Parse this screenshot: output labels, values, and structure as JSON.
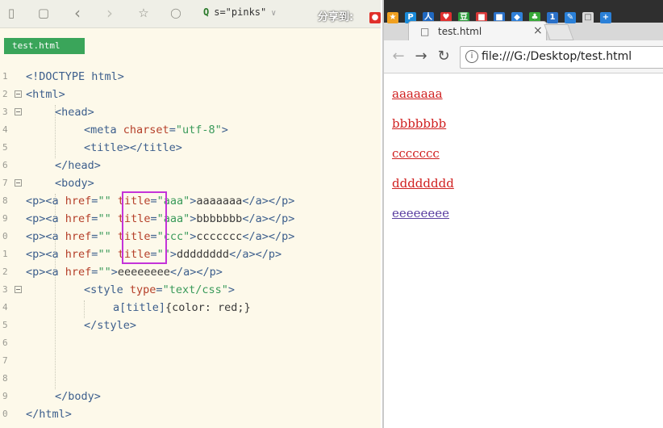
{
  "editor": {
    "search_text": "s=\"pinks\"",
    "tab_label": "test.html",
    "lines": [
      {
        "num": "1",
        "parts": [
          [
            "tag",
            "<!DOCTYPE html>"
          ]
        ]
      },
      {
        "num": "2",
        "parts": [
          [
            "tag",
            "<html>"
          ]
        ]
      },
      {
        "num": "3",
        "parts": [
          [
            "tag",
            "<head>"
          ]
        ]
      },
      {
        "num": "4",
        "parts": [
          [
            "tag",
            "<meta "
          ],
          [
            "attr",
            "charset"
          ],
          [
            "tag",
            "="
          ],
          [
            "str",
            "\"utf-8\""
          ],
          [
            "tag",
            ">"
          ]
        ]
      },
      {
        "num": "5",
        "parts": [
          [
            "tag",
            "<title></title>"
          ]
        ]
      },
      {
        "num": "6",
        "parts": [
          [
            "tag",
            "</head>"
          ]
        ]
      },
      {
        "num": "7",
        "parts": [
          [
            "tag",
            "<body>"
          ]
        ]
      },
      {
        "num": "8",
        "parts": [
          [
            "tag",
            "<p><a "
          ],
          [
            "attr",
            "href"
          ],
          [
            "tag",
            "="
          ],
          [
            "str",
            "\"\""
          ],
          [
            "tag",
            " "
          ],
          [
            "attr",
            "title"
          ],
          [
            "tag",
            "="
          ],
          [
            "str",
            "\"aaa\""
          ],
          [
            "tag",
            ">"
          ],
          [
            "txt",
            "aaaaaaa"
          ],
          [
            "tag",
            "</a></p>"
          ]
        ]
      },
      {
        "num": "9",
        "parts": [
          [
            "tag",
            "<p><a "
          ],
          [
            "attr",
            "href"
          ],
          [
            "tag",
            "="
          ],
          [
            "str",
            "\"\""
          ],
          [
            "tag",
            " "
          ],
          [
            "attr",
            "title"
          ],
          [
            "tag",
            "="
          ],
          [
            "str",
            "\"aaa\""
          ],
          [
            "tag",
            ">"
          ],
          [
            "txt",
            "bbbbbbb"
          ],
          [
            "tag",
            "</a></p>"
          ]
        ]
      },
      {
        "num": "0",
        "parts": [
          [
            "tag",
            "<p><a "
          ],
          [
            "attr",
            "href"
          ],
          [
            "tag",
            "="
          ],
          [
            "str",
            "\"\""
          ],
          [
            "tag",
            " "
          ],
          [
            "attr",
            "title"
          ],
          [
            "tag",
            "="
          ],
          [
            "str",
            "\"ccc\""
          ],
          [
            "tag",
            ">"
          ],
          [
            "txt",
            "ccccccc"
          ],
          [
            "tag",
            "</a></p>"
          ]
        ]
      },
      {
        "num": "1",
        "parts": [
          [
            "tag",
            "<p><a "
          ],
          [
            "attr",
            "href"
          ],
          [
            "tag",
            "="
          ],
          [
            "str",
            "\"\""
          ],
          [
            "tag",
            " "
          ],
          [
            "attr",
            "title"
          ],
          [
            "tag",
            "="
          ],
          [
            "str",
            "\"\""
          ],
          [
            "tag",
            ">"
          ],
          [
            "txt",
            "dddddddd"
          ],
          [
            "tag",
            "</a></p>"
          ]
        ]
      },
      {
        "num": "2",
        "parts": [
          [
            "tag",
            "<p><a "
          ],
          [
            "attr",
            "href"
          ],
          [
            "tag",
            "="
          ],
          [
            "str",
            "\"\""
          ],
          [
            "tag",
            ">"
          ],
          [
            "txt",
            "eeeeeeee"
          ],
          [
            "tag",
            "</a></p>"
          ]
        ]
      },
      {
        "num": "3",
        "parts": [
          [
            "tag",
            "<style "
          ],
          [
            "attr",
            "type"
          ],
          [
            "tag",
            "="
          ],
          [
            "str",
            "\"text/css\""
          ],
          [
            "tag",
            ">"
          ]
        ]
      },
      {
        "num": "4",
        "parts": [
          [
            "css-sel",
            "a[title]"
          ],
          [
            "txt",
            "{color: red;}"
          ]
        ]
      },
      {
        "num": "5",
        "parts": [
          [
            "tag",
            "</style>"
          ]
        ]
      },
      {
        "num": "6",
        "parts": []
      },
      {
        "num": "7",
        "parts": []
      },
      {
        "num": "8",
        "parts": []
      },
      {
        "num": "9",
        "parts": [
          [
            "tag",
            "</body>"
          ]
        ]
      },
      {
        "num": "0",
        "parts": [
          [
            "tag",
            "</html>"
          ]
        ]
      }
    ]
  },
  "browser": {
    "share_label": "分享到:",
    "tab_title": "test.html",
    "url": "file:///G:/Desktop/test.html",
    "links": [
      "aaaaaaa",
      "bbbbbbb",
      "ccccccc",
      "dddddddd",
      "eeeeeeee"
    ]
  },
  "colors": {
    "editor_bg": "#fdf9ea",
    "tab_green": "#3aa55a",
    "highlight_box": "#c433d9",
    "link_red": "#d02020",
    "link_default": "#5a3ea0"
  }
}
